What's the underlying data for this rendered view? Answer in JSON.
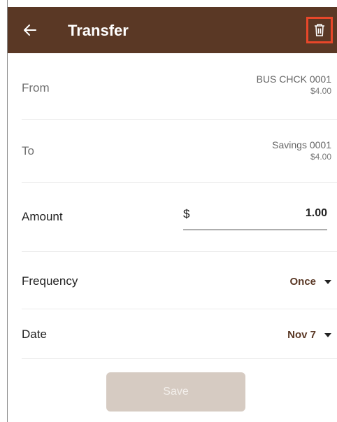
{
  "header": {
    "title": "Transfer"
  },
  "from": {
    "label": "From",
    "account_name": "BUS CHCK 0001",
    "balance": "$4.00"
  },
  "to": {
    "label": "To",
    "account_name": "Savings 0001",
    "balance": "$4.00"
  },
  "amount": {
    "label": "Amount",
    "currency": "$",
    "value": "1.00"
  },
  "frequency": {
    "label": "Frequency",
    "value": "Once"
  },
  "date": {
    "label": "Date",
    "value": "Nov 7"
  },
  "save_button": {
    "label": "Save"
  },
  "colors": {
    "appbar": "#5a3825",
    "highlight": "#e8472a",
    "accent": "#5a3825",
    "save_disabled": "#d6cbc2"
  },
  "icons": {
    "back": "arrow-left-icon",
    "delete": "trash-icon",
    "dropdown": "caret-down-icon"
  }
}
